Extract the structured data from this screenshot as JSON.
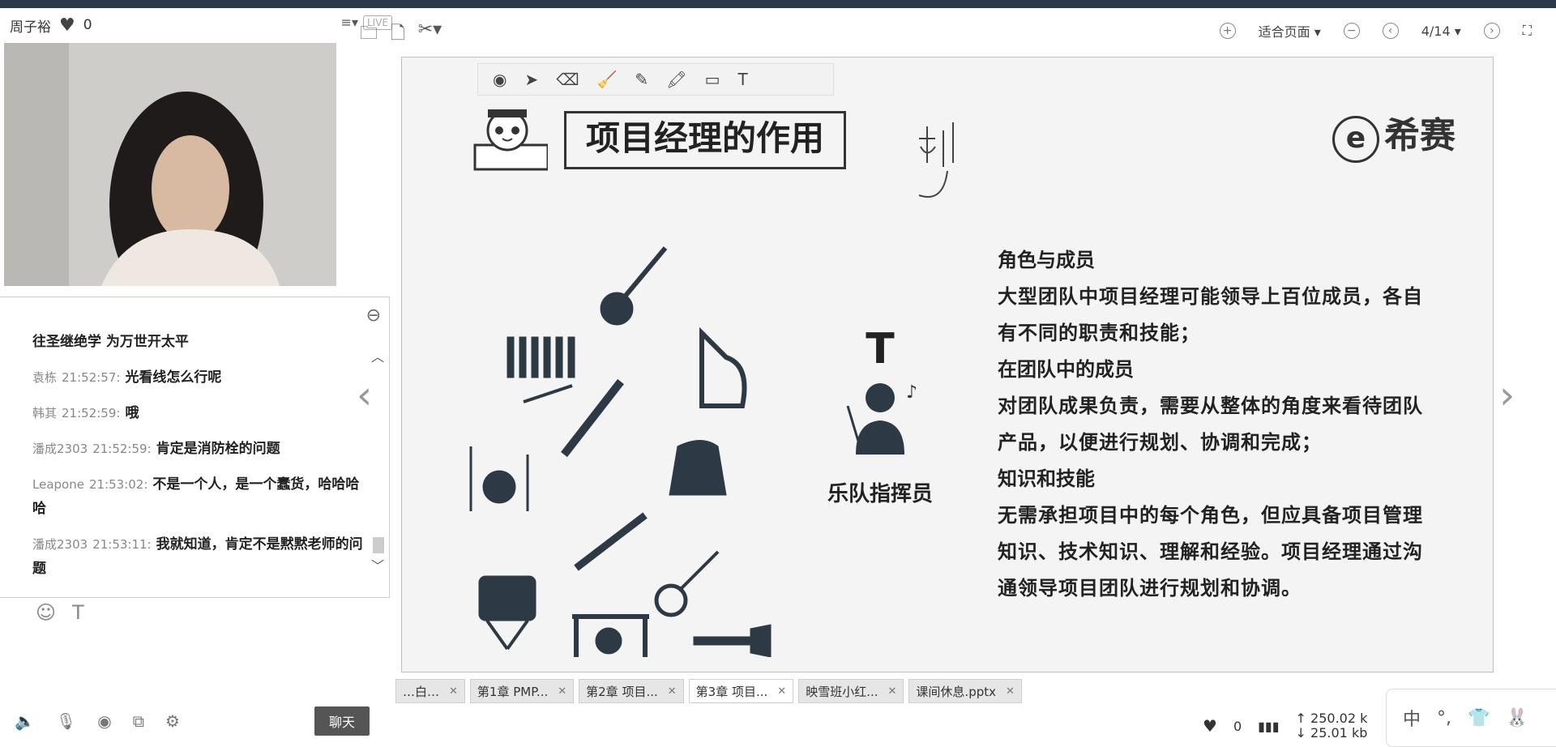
{
  "user": {
    "name": "周子裕",
    "likes": "0",
    "live_badge": "LIVE"
  },
  "chat": {
    "messages": [
      {
        "name": "",
        "time": "",
        "text": "往圣继绝学 为万世开太平"
      },
      {
        "name": "袁栋",
        "time": "21:52:57:",
        "text": "光看线怎么行呢"
      },
      {
        "name": "韩其",
        "time": "21:52:59:",
        "text": "哦"
      },
      {
        "name": "潘成2303",
        "time": "21:52:59:",
        "text": "肯定是消防栓的问题"
      },
      {
        "name": "Leapone",
        "time": "21:53:02:",
        "text": "不是一个人，是一个蠢货，哈哈哈哈"
      },
      {
        "name": "潘成2303",
        "time": "21:53:11:",
        "text": "我就知道，肯定不是黙黙老师的问题"
      }
    ],
    "chat_button": "聊天"
  },
  "toolbar": {
    "zoom": "适合页面",
    "page": "4/14"
  },
  "slide": {
    "title": "项目经理的作用",
    "logo": "希赛",
    "t_label": "T",
    "role": "乐队指挥员",
    "sections": [
      {
        "heading": "角色与成员",
        "body": "大型团队中项目经理可能领导上百位成员，各自有不同的职责和技能；"
      },
      {
        "heading": "在团队中的成员",
        "body": "对团队成果负责，需要从整体的角度来看待团队产品，以便进行规划、协调和完成；"
      },
      {
        "heading": "知识和技能",
        "body": "无需承担项目中的每个角色，但应具备项目管理知识、技术知识、理解和经验。项目经理通过沟通领导项目团队进行规划和协调。"
      }
    ]
  },
  "tabs": [
    {
      "label": "…白…"
    },
    {
      "label": "第1章 PMP..."
    },
    {
      "label": "第2章 项目..."
    },
    {
      "label": "第3章 项目..."
    },
    {
      "label": "映雪班小红..."
    },
    {
      "label": "课间休息.pptx"
    }
  ],
  "status": {
    "likes": "0",
    "upload": "250.02 k",
    "download": "25.01 kb"
  },
  "ime": {
    "lang": "中"
  }
}
